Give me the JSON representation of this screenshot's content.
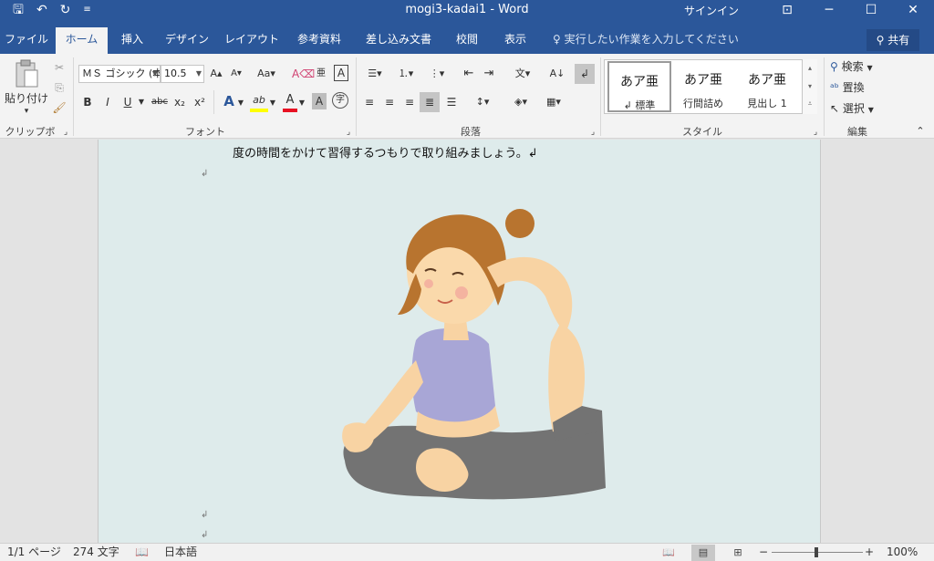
{
  "titlebar": {
    "title": "mogi3-kadai1  -  Word",
    "signin": "サインイン",
    "qat_icons": [
      "save-icon",
      "undo-icon",
      "redo-icon",
      "customize-qat-icon"
    ],
    "save_glyph": "🖫",
    "undo_glyph": "↶",
    "redo_glyph": "↻",
    "customize_glyph": "≡",
    "ribbon_opts_glyph": "⊡",
    "minimize_glyph": "─",
    "maximize_glyph": "☐",
    "close_glyph": "✕"
  },
  "tabs": [
    {
      "label": "ファイル",
      "active": false
    },
    {
      "label": "ホーム",
      "active": true
    },
    {
      "label": "挿入",
      "active": false
    },
    {
      "label": "デザイン",
      "active": false
    },
    {
      "label": "レイアウト",
      "active": false
    },
    {
      "label": "参考資料",
      "active": false
    },
    {
      "label": "差し込み文書",
      "active": false
    },
    {
      "label": "校閲",
      "active": false
    },
    {
      "label": "表示",
      "active": false
    }
  ],
  "tellme": {
    "icon": "lightbulb-icon",
    "glyph": "♀",
    "text": "実行したい作業を入力してください"
  },
  "share": {
    "icon": "person-icon",
    "glyph": "⚲",
    "label": "共有"
  },
  "ribbon": {
    "clipboard": {
      "label": "クリップボード",
      "paste_label": "貼り付け",
      "paste_dropdown": "▾",
      "cut_glyph": "✂",
      "copy_glyph": "⎘",
      "format_painter_glyph": "🖌",
      "launcher_glyph": "⌟"
    },
    "font": {
      "label": "フォント",
      "font_name": "ＭＳ ゴシック (本",
      "font_size": "10.5",
      "grow_glyph": "A▴",
      "shrink_glyph": "A▾",
      "case_glyph": "Aa▾",
      "clear_glyph": "A⌫",
      "phonetic_glyph": "亜",
      "border_glyph": "A",
      "bold": "B",
      "italic": "I",
      "underline": "U",
      "strike": "abc",
      "subscript": "x₂",
      "superscript": "x²",
      "effects_glyph": "A",
      "highlight_glyph": "ab",
      "color_glyph": "A",
      "shade_glyph": "A",
      "enclose_glyph": "字",
      "launcher_glyph": "⌟"
    },
    "paragraph": {
      "label": "段落",
      "bullets_glyph": "☰▾",
      "numbering_glyph": "⒈▾",
      "multilevel_glyph": "⋮▾",
      "decrease_indent_glyph": "⇤",
      "increase_indent_glyph": "⇥",
      "asian_layout_glyph": "文▾",
      "sort_glyph": "A↓",
      "show_marks_glyph": "↲",
      "align_left_glyph": "≡",
      "align_center_glyph": "≡",
      "align_right_glyph": "≡",
      "justify_glyph": "≣",
      "distributed_glyph": "☰",
      "line_spacing_glyph": "↕▾",
      "shading_glyph": "◈▾",
      "borders_glyph": "▦▾",
      "launcher_glyph": "⌟"
    },
    "styles": {
      "label": "スタイル",
      "items": [
        {
          "sample": "あア亜",
          "name": "↲ 標準"
        },
        {
          "sample": "あア亜",
          "name": "行間詰め"
        },
        {
          "sample": "あア亜",
          "name": "見出し 1"
        }
      ],
      "scroll_up": "▴",
      "scroll_down": "▾",
      "more": "⩡",
      "launcher_glyph": "⌟"
    },
    "editing": {
      "label": "編集",
      "find_label": "検索",
      "find_glyph": "⚲",
      "replace_label": "置換",
      "replace_glyph": "ᵃᵇ",
      "select_label": "選択",
      "select_glyph": "↖",
      "collapse_glyph": "⌃"
    }
  },
  "document": {
    "line1": "度の時間をかけて習得するつもりで取り組みましょう。↲",
    "para_mark": "↲"
  },
  "status": {
    "page": "1/1 ページ",
    "words": "274 文字",
    "proof_glyph": "📖",
    "language": "日本語",
    "read_mode_glyph": "📖",
    "print_layout_glyph": "▤",
    "web_layout_glyph": "⊞",
    "zoom_out": "−",
    "zoom_in": "+",
    "zoom": "100%",
    "zoom_level_percent": 100
  },
  "colors": {
    "accent": "#2b579a",
    "page_bg": "#deebeb",
    "highlight": "#ffff00",
    "font_color": "#e81123"
  }
}
